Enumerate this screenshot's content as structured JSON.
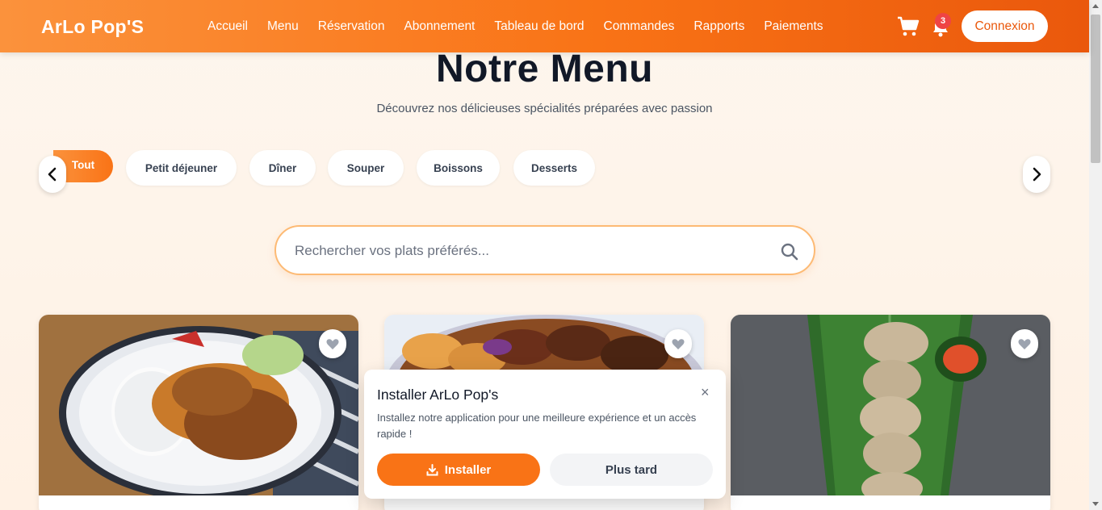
{
  "header": {
    "brand": "ArLo Pop'S",
    "nav": [
      "Accueil",
      "Menu",
      "Réservation",
      "Abonnement",
      "Tableau de bord",
      "Commandes",
      "Rapports",
      "Paiements"
    ],
    "notification_count": "3",
    "login_label": "Connexion",
    "colors": {
      "primary": "#f97316",
      "primary_dark": "#ea580c",
      "badge": "#ef4444"
    }
  },
  "hero": {
    "title": "Notre Menu",
    "subtitle": "Découvrez nos délicieuses spécialités préparées avec passion"
  },
  "categories": {
    "active": "Tout",
    "items": [
      "Petit déjeuner",
      "Dîner",
      "Souper",
      "Boissons",
      "Desserts"
    ]
  },
  "search": {
    "placeholder": "Rechercher vos plats préférés...",
    "value": ""
  },
  "install_prompt": {
    "title": "Installer ArLo Pop's",
    "description": "Installez notre application pour une meilleure expérience et un accès rapide !",
    "install_label": "Installer",
    "later_label": "Plus tard",
    "close_glyph": "×"
  },
  "icons": [
    "cart-icon",
    "bell-icon",
    "chevron-left-icon",
    "chevron-right-icon",
    "search-icon",
    "heart-icon",
    "download-icon",
    "close-icon"
  ]
}
